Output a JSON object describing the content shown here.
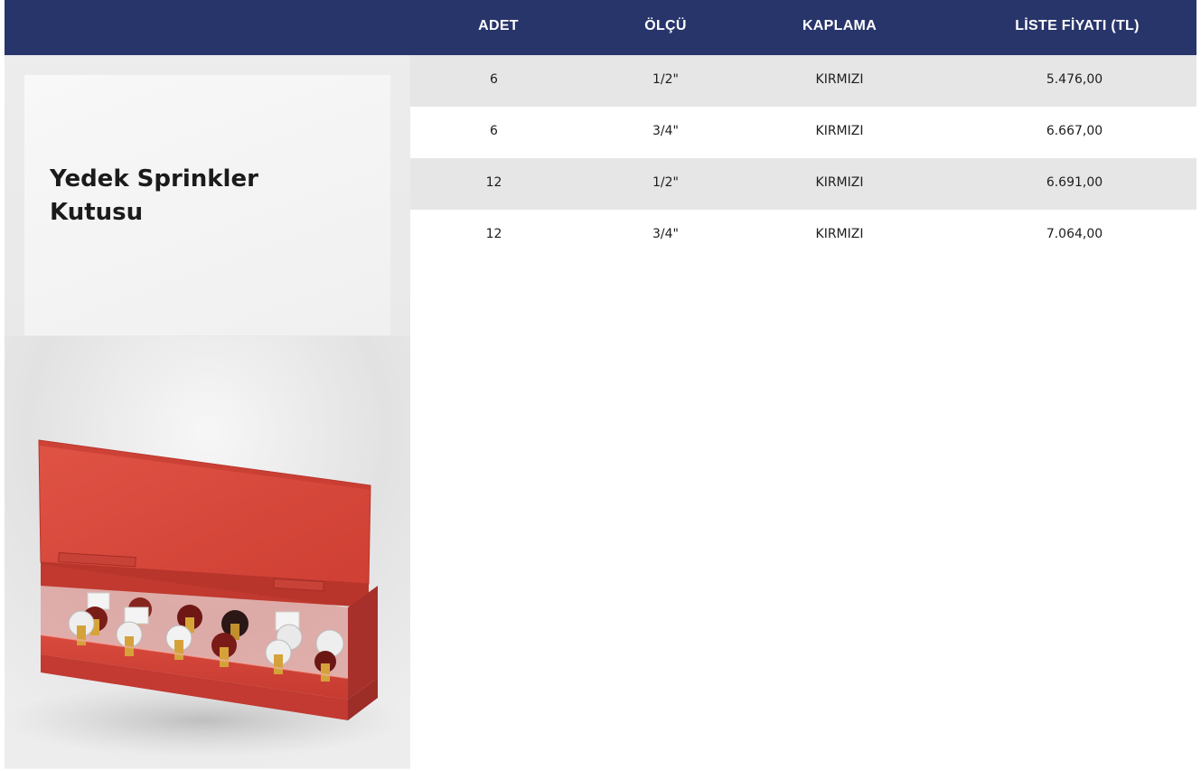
{
  "table": {
    "headers": [
      "ADET",
      "ÖLÇÜ",
      "KAPLAMA",
      "LİSTE FİYATI (TL)"
    ],
    "rows": [
      {
        "adet": "6",
        "olcu": "1/2\"",
        "kaplama": "KIRMIZI",
        "fiyat": "5.476,00"
      },
      {
        "adet": "6",
        "olcu": "3/4\"",
        "kaplama": "KIRMIZI",
        "fiyat": "6.667,00"
      },
      {
        "adet": "12",
        "olcu": "1/2\"",
        "kaplama": "KIRMIZI",
        "fiyat": "6.691,00"
      },
      {
        "adet": "12",
        "olcu": "3/4\"",
        "kaplama": "KIRMIZI",
        "fiyat": "7.064,00"
      }
    ]
  },
  "product": {
    "title_line1": "Yedek Sprinkler",
    "title_line2": "Kutusu"
  },
  "colors": {
    "header_bg": "#28356b",
    "row_shaded": "#e6e6e7",
    "box_red": "#d8473a"
  },
  "icons": {
    "product_image": "sprinkler-box-image"
  }
}
